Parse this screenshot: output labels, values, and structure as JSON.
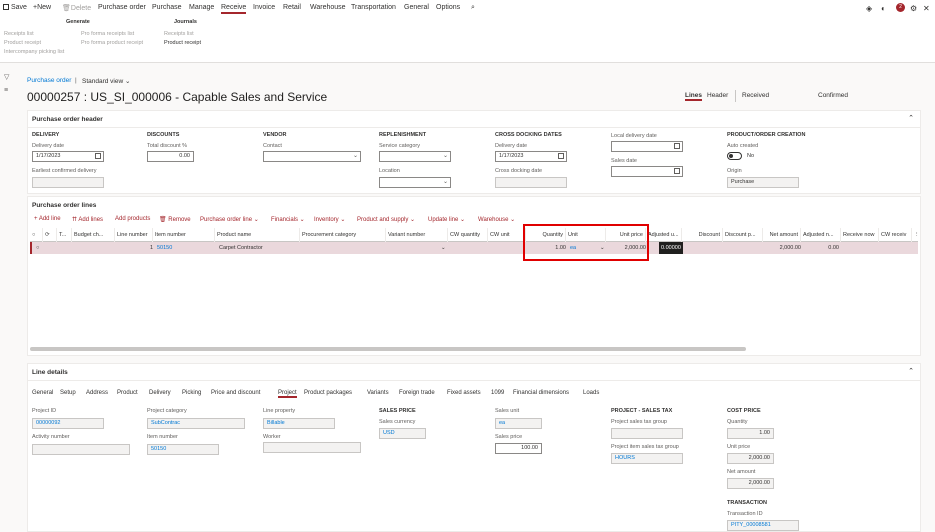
{
  "ribbon": {
    "tabs": [
      "Save",
      "New",
      "Delete",
      "Purchase order",
      "Purchase",
      "Manage",
      "Receive",
      "Invoice",
      "Retail",
      "Warehouse",
      "Transportation",
      "General",
      "Options"
    ],
    "active_tab": "Receive",
    "generate": {
      "title": "Generate",
      "links": [
        "Receipts list",
        "Product receipt",
        "Intercompany picking list",
        "Pro forma receipts list",
        "Pro forma product receipt"
      ]
    },
    "journals": {
      "title": "Journals",
      "links": [
        "Receipts list",
        "Product receipt"
      ]
    },
    "notification_count": "2"
  },
  "breadcrumb": {
    "link": "Purchase order",
    "sep": "|",
    "view": "Standard view"
  },
  "page_title": "00000257 : US_SI_000006 - Capable Sales and Service",
  "view_tabs": {
    "lines": "Lines",
    "header": "Header",
    "status1": "Received",
    "status2": "Confirmed"
  },
  "header_section": {
    "title": "Purchase order header",
    "delivery": {
      "head": "DELIVERY",
      "date_label": "Delivery date",
      "date_value": "1/17/2023",
      "earliest_label": "Earliest confirmed delivery",
      "earliest_value": ""
    },
    "discounts": {
      "head": "DISCOUNTS",
      "total_label": "Total discount %",
      "total_value": "0.00"
    },
    "vendor": {
      "head": "VENDOR",
      "contact_label": "Contact",
      "contact_value": ""
    },
    "replenishment": {
      "head": "REPLENISHMENT",
      "service_label": "Service category",
      "service_value": "",
      "location_label": "Location",
      "location_value": ""
    },
    "cross_docking": {
      "head": "CROSS DOCKING DATES",
      "delivery_label": "Delivery date",
      "delivery_value": "1/17/2023",
      "cross_label": "Cross docking date",
      "cross_value": ""
    },
    "local": {
      "local_label": "Local delivery date",
      "local_value": "",
      "sales_label": "Sales date",
      "sales_value": ""
    },
    "creation": {
      "head": "PRODUCT/ORDER CREATION",
      "auto_label": "Auto created",
      "auto_value": "No",
      "origin_label": "Origin",
      "origin_value": "Purchase"
    }
  },
  "lines_section": {
    "title": "Purchase order lines",
    "toolbar": [
      "Add line",
      "Add lines",
      "Add products",
      "Remove",
      "Purchase order line",
      "Financials",
      "Inventory",
      "Product and supply",
      "Update line",
      "Warehouse"
    ],
    "columns": [
      "T...",
      "Budget ch...",
      "Line number",
      "Item number",
      "Product name",
      "Procurement category",
      "Variant number",
      "CW quantity",
      "CW unit",
      "Quantity",
      "Unit",
      "Unit price",
      "Adjusted u...",
      "Discount",
      "Discount p...",
      "Net amount",
      "Adjusted n...",
      "Receive now",
      "CW receiv"
    ],
    "row": {
      "line_number": "1",
      "item_number": "50150",
      "product_name": "Carpet Contractor",
      "quantity": "1.00",
      "unit": "ea",
      "unit_price": "2,000.00",
      "adjusted_unit": "0.00000",
      "net_amount": "2,000.00",
      "adjusted_net": "0.00"
    }
  },
  "line_details": {
    "title": "Line details",
    "tabs": [
      "General",
      "Setup",
      "Address",
      "Product",
      "Delivery",
      "Picking",
      "Price and discount",
      "Project",
      "Product packages",
      "Variants",
      "Foreign trade",
      "Fixed assets",
      "1099",
      "Financial dimensions",
      "Loads"
    ],
    "active_tab": "Project",
    "project_id_label": "Project ID",
    "project_id": "00000092",
    "activity_label": "Activity number",
    "activity": "",
    "category_label": "Project category",
    "category": "SubContrac",
    "item_label": "Item number",
    "item": "50150",
    "line_property_label": "Line property",
    "line_property": "Billable",
    "worker_label": "Worker",
    "worker": "",
    "sales_price_head": "SALES PRICE",
    "currency_label": "Sales currency",
    "currency": "USD",
    "sales_unit_label": "Sales unit",
    "sales_unit": "ea",
    "sales_price_label": "Sales price",
    "sales_price": "100.00",
    "tax_head": "PROJECT - SALES TAX",
    "tax_group_label": "Project sales tax group",
    "tax_group": "",
    "item_tax_label": "Project item sales tax group",
    "item_tax": "HOURS",
    "cost_head": "COST PRICE",
    "qty_label": "Quantity",
    "qty": "1.00",
    "cost_unit_label": "Unit price",
    "cost_unit": "2,000.00",
    "net_label": "Net amount",
    "net": "2,000.00",
    "transaction_head": "TRANSACTION",
    "trans_id_label": "Transaction ID",
    "trans_id": "PITY_00008581"
  },
  "colors": {
    "accent": "#a4262c",
    "link": "#0078d4",
    "highlight": "#e00000",
    "selected_row": "#ead8dc"
  }
}
